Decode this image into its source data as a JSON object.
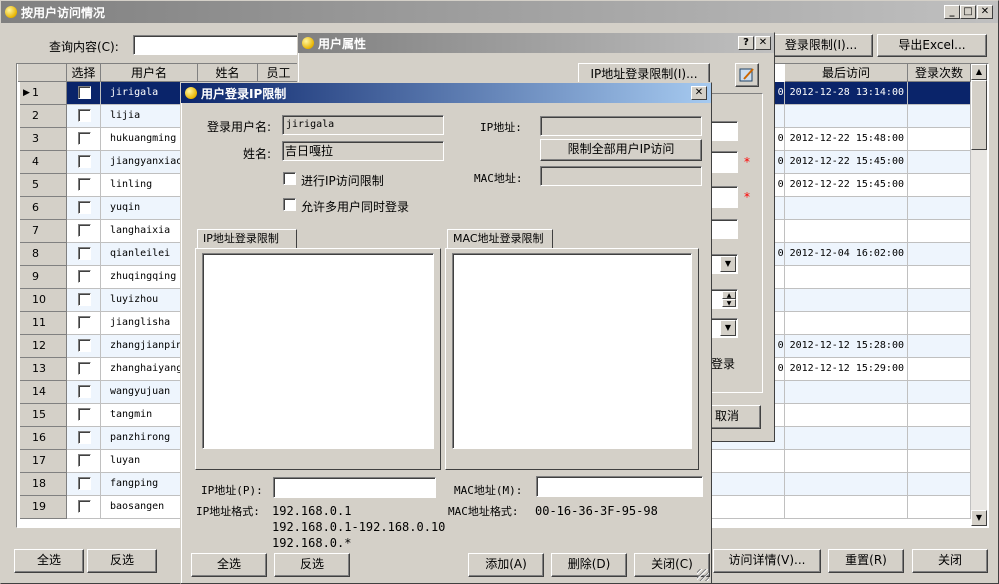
{
  "main": {
    "title": "按用户访问情况",
    "query_label": "查询内容(C):",
    "login_limit_btn": "登录限制(I)...",
    "export_btn": "导出Excel...",
    "columns": [
      "选择",
      "用户名",
      "姓名",
      "员工",
      "最后访问",
      "登录次数"
    ],
    "rows": [
      {
        "n": "1",
        "user": "jirigala",
        "last": "0 2012-12-28 13:14:00"
      },
      {
        "n": "2",
        "user": "lijia",
        "last": ""
      },
      {
        "n": "3",
        "user": "hukuangming",
        "last": "0 2012-12-22 15:48:00"
      },
      {
        "n": "4",
        "user": "jiangyanxiao",
        "last": "0 2012-12-22 15:45:00"
      },
      {
        "n": "5",
        "user": "linling",
        "last": "0 2012-12-22 15:45:00"
      },
      {
        "n": "6",
        "user": "yuqin",
        "last": ""
      },
      {
        "n": "7",
        "user": "langhaixia",
        "last": ""
      },
      {
        "n": "8",
        "user": "qianleilei",
        "last": "0 2012-12-04 16:02:00"
      },
      {
        "n": "9",
        "user": "zhuqingqing",
        "last": ""
      },
      {
        "n": "10",
        "user": "luyizhou",
        "last": ""
      },
      {
        "n": "11",
        "user": "jianglisha",
        "last": ""
      },
      {
        "n": "12",
        "user": "zhangjianpin",
        "last": "0 2012-12-12 15:28:00"
      },
      {
        "n": "13",
        "user": "zhanghaiyang",
        "last": "0 2012-12-12 15:29:00"
      },
      {
        "n": "14",
        "user": "wangyujuan",
        "last": ""
      },
      {
        "n": "15",
        "user": "tangmin",
        "last": ""
      },
      {
        "n": "16",
        "user": "panzhirong",
        "last": ""
      },
      {
        "n": "17",
        "user": "luyan",
        "last": ""
      },
      {
        "n": "18",
        "user": "fangping",
        "last": ""
      },
      {
        "n": "19",
        "user": "baosangen",
        "last": ""
      }
    ],
    "select_all": "全选",
    "invert": "反选",
    "visit_detail": "访问详情(V)...",
    "reset": "重置(R)",
    "close": "关闭"
  },
  "props": {
    "title": "用户属性",
    "ip_limit_btn": "IP地址登录限制(I)...",
    "login_text": "登录",
    "cancel": "取消"
  },
  "ipdlg": {
    "title": "用户登录IP限制",
    "login_name_label": "登录用户名:",
    "login_name_value": "jirigala",
    "name_label": "姓名:",
    "name_value": "吉日嘎拉",
    "ip_label": "IP地址:",
    "mac_label": "MAC地址:",
    "limit_all_btn": "限制全部用户IP访问",
    "chk_ip_limit": "进行IP访问限制",
    "chk_multi": "允许多用户同时登录",
    "tab_ip": "IP地址登录限制",
    "tab_mac": "MAC地址登录限制",
    "ip_input_label": "IP地址(P):",
    "mac_input_label": "MAC地址(M):",
    "ip_format_label": "IP地址格式:",
    "ip_format_1": "192.168.0.1",
    "ip_format_2": "192.168.0.1-192.168.0.10",
    "ip_format_3": "192.168.0.*",
    "mac_format_label": "MAC地址格式:",
    "mac_format_value": "00-16-36-3F-95-98",
    "select_all": "全选",
    "invert": "反选",
    "add": "添加(A)",
    "delete": "删除(D)",
    "close": "关闭(C)"
  },
  "colors": {
    "title_active": "#0a246a",
    "title_inactive": "#808080",
    "selection": "#0a246a",
    "required": "#ff0000"
  }
}
